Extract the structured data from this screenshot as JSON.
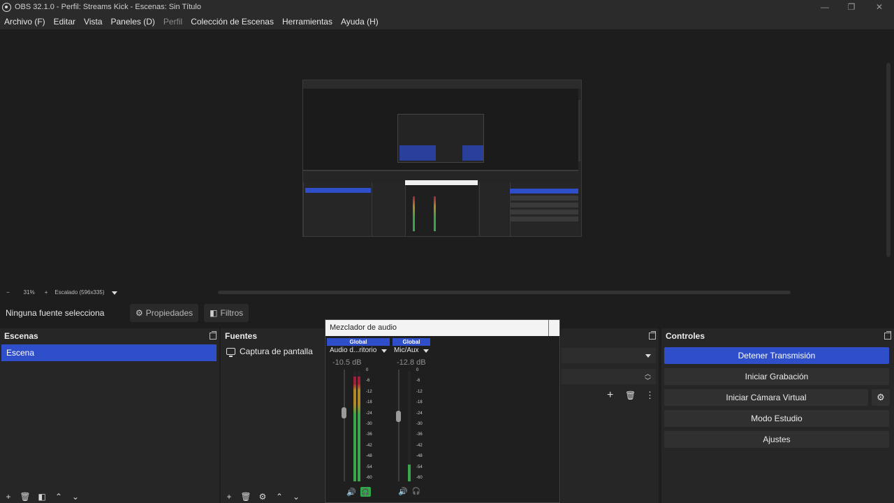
{
  "window": {
    "title": "OBS 32.1.0 - Perfil: Streams Kick - Escenas: Sin Título",
    "minimize_icon": "—",
    "maximize_icon": "❐",
    "close_icon": "✕"
  },
  "menu": [
    "Archivo (F)",
    "Editar",
    "Vista",
    "Paneles (D)",
    "Perfil",
    "Colección de Escenas",
    "Herramientas",
    "Ayuda (H)"
  ],
  "zoom": {
    "minus": "−",
    "value": "31%",
    "plus": "+",
    "mode": "Escalado (596x335)"
  },
  "source_bar": {
    "no_source": "Ninguna fuente selecciona",
    "properties": "Propiedades",
    "filters": "Filtros"
  },
  "docks": {
    "scenes": {
      "title": "Escenas",
      "items": [
        "Escena"
      ]
    },
    "sources": {
      "title": "Fuentes",
      "items": [
        "Captura de pantalla"
      ]
    },
    "controls": {
      "title": "Controles"
    }
  },
  "controls": {
    "stop_stream": "Detener Transmisión",
    "start_recording": "Iniciar Grabación",
    "start_virtualcam": "Iniciar Cámara Virtual",
    "studio_mode": "Modo Estudio",
    "settings": "Ajustes"
  },
  "mixer": {
    "title": "Mezclador de audio",
    "channels": [
      {
        "badge": "Global",
        "name": "Audio d...ritorio",
        "db": "-10.5 dB",
        "level": 0.95
      },
      {
        "badge": "Global",
        "name": "Mic/Aux",
        "db": "-12.8 dB",
        "level": 0.15
      }
    ],
    "scale": [
      "0",
      "-6",
      "-12",
      "-18",
      "-24",
      "-30",
      "-36",
      "-42",
      "-48",
      "-54",
      "-60"
    ]
  },
  "colors": {
    "accent": "#2f4ec9",
    "meter_red": "#a21f3a",
    "meter_yellow": "#b08a28",
    "meter_green": "#3aa54a"
  }
}
